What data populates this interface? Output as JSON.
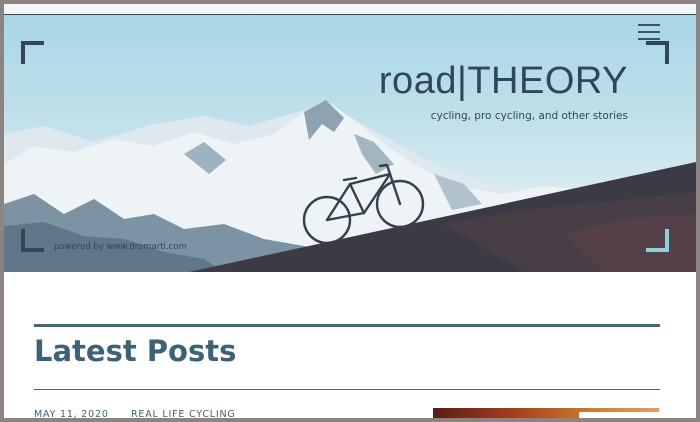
{
  "header": {
    "site_title": "road|THEORY",
    "tagline": "cycling, pro cycling, and other stories",
    "powered_by": "powered by www.dromarti.com"
  },
  "main": {
    "section_title": "Latest Posts",
    "posts": [
      {
        "date": "MAY 11, 2020",
        "category": "REAL LIFE CYCLING"
      }
    ]
  },
  "colors": {
    "accent": "#45697c",
    "text": "#2f4756",
    "hill": "#3b3a45"
  },
  "icons": {
    "menu": "hamburger-icon",
    "bicycle": "bicycle-icon"
  }
}
